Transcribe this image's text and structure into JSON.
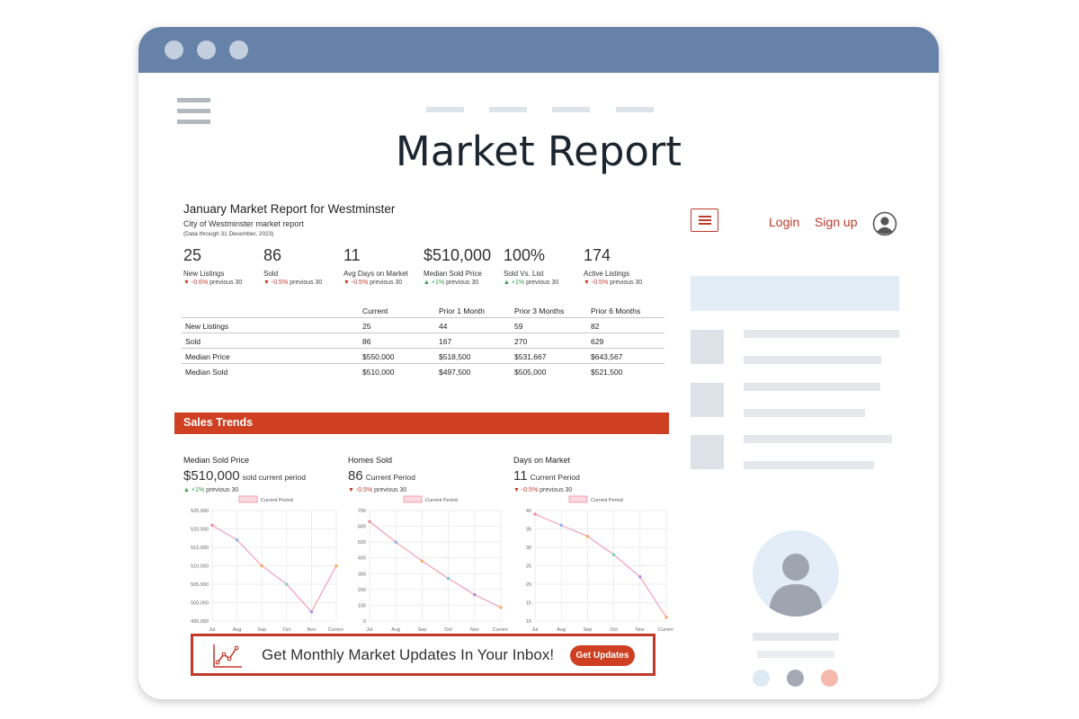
{
  "page": {
    "title": "Market Report"
  },
  "report": {
    "title": "January Market Report for Westminster",
    "subtitle": "City of Westminster market report",
    "note": "(Data through 31 December, 2023)"
  },
  "kpis": [
    {
      "value": "25",
      "label": "New Listings",
      "arrow": "▼",
      "change": "-0.6%",
      "suffix": "previous 30",
      "dir": "dn"
    },
    {
      "value": "86",
      "label": "Sold",
      "arrow": "▼",
      "change": "-0.5%",
      "suffix": "previous 30",
      "dir": "dn"
    },
    {
      "value": "11",
      "label": "Avg Days on Market",
      "arrow": "▼",
      "change": "-0.5%",
      "suffix": "previous 30",
      "dir": "dn"
    },
    {
      "value": "$510,000",
      "label": "Median Sold Price",
      "arrow": "▲",
      "change": "+1%",
      "suffix": "previous 30",
      "dir": "up"
    },
    {
      "value": "100%",
      "label": "Sold Vs. List",
      "arrow": "▲",
      "change": "+1%",
      "suffix": "previous 30",
      "dir": "up"
    },
    {
      "value": "174",
      "label": "Active Listings",
      "arrow": "▼",
      "change": "-0.5%",
      "suffix": "previous 30",
      "dir": "dn"
    }
  ],
  "table": {
    "columns": [
      "",
      "Current",
      "Prior 1 Month",
      "Prior 3 Months",
      "Prior 6 Months"
    ],
    "rows": [
      [
        "New Listings",
        "25",
        "44",
        "59",
        "82"
      ],
      [
        "Sold",
        "86",
        "167",
        "270",
        "629"
      ],
      [
        "Median Price",
        "$550,000",
        "$518,500",
        "$531,667",
        "$643,567"
      ],
      [
        "Median Sold",
        "$510,000",
        "$497,500",
        "$505,000",
        "$521,500"
      ]
    ]
  },
  "section": {
    "title": "Sales Trends"
  },
  "trends": [
    {
      "title": "Median Sold Price",
      "value": "$510,000",
      "value_suffix": "sold current period",
      "arrow": "▲",
      "change": "+1%",
      "change_suffix": "previous 30",
      "dir": "up"
    },
    {
      "title": "Homes Sold",
      "value": "86",
      "value_suffix": "Current Period",
      "arrow": "▼",
      "change": "-0.5%",
      "change_suffix": "previous 30",
      "dir": "dn"
    },
    {
      "title": "Days on Market",
      "value": "11",
      "value_suffix": "Current Period",
      "arrow": "▼",
      "change": "-0.5%",
      "change_suffix": "previous 30",
      "dir": "dn"
    }
  ],
  "chart_data": [
    {
      "type": "line",
      "legend": "Current Period",
      "x": [
        "Jul",
        "Aug",
        "Sep",
        "Oct",
        "Nov",
        "Current"
      ],
      "values": [
        521000,
        517000,
        510000,
        505000,
        497500,
        510000
      ],
      "ylim": [
        495000,
        525000
      ],
      "yticks": [
        495000,
        500000,
        505000,
        510000,
        515000,
        520000,
        525000
      ],
      "ytick_labels": [
        "495,000",
        "500,000",
        "505,000",
        "510,000",
        "515,000",
        "520,000",
        "525,000"
      ],
      "point_colors": [
        "#f08fa5",
        "#8fb4e8",
        "#f5b06a",
        "#7fd0c8",
        "#b48ee8",
        "#f5b06a"
      ],
      "grid": true,
      "legend_position": "top"
    },
    {
      "type": "line",
      "legend": "Current Period",
      "x": [
        "Jul",
        "Aug",
        "Sep",
        "Oct",
        "Nov",
        "Current"
      ],
      "values": [
        630,
        500,
        380,
        270,
        167,
        86
      ],
      "ylim": [
        0,
        700
      ],
      "yticks": [
        0,
        100,
        200,
        300,
        400,
        500,
        600,
        700
      ],
      "ytick_labels": [
        "0",
        "100",
        "200",
        "300",
        "400",
        "500",
        "600",
        "700"
      ],
      "point_colors": [
        "#f08fa5",
        "#8fb4e8",
        "#f5b06a",
        "#7fd0c8",
        "#b48ee8",
        "#f5b06a"
      ],
      "grid": true,
      "legend_position": "top"
    },
    {
      "type": "line",
      "legend": "Current Period",
      "x": [
        "Jul",
        "Aug",
        "Sep",
        "Oct",
        "Nov",
        "Current"
      ],
      "values": [
        39,
        36,
        33,
        28,
        22,
        11
      ],
      "ylim": [
        10,
        40
      ],
      "yticks": [
        10,
        15,
        20,
        25,
        30,
        35,
        40
      ],
      "ytick_labels": [
        "10",
        "15",
        "20",
        "25",
        "30",
        "35",
        "40"
      ],
      "point_colors": [
        "#f08fa5",
        "#8fb4e8",
        "#f5b06a",
        "#7fd0c8",
        "#b48ee8",
        "#f5b06a"
      ],
      "grid": true,
      "legend_position": "top"
    }
  ],
  "cta": {
    "text": "Get Monthly Market Updates In Your Inbox!",
    "button": "Get Updates"
  },
  "sidebar": {
    "login": "Login",
    "signup": "Sign up"
  },
  "colors": {
    "titlebar": "#6782a8",
    "accent": "#cf3f21",
    "down": "#c0392b",
    "up": "#2e9a45",
    "chart_line": "#f08fa5"
  },
  "icons": [
    "hamburger-menu-icon",
    "user-circle-icon",
    "line-chart-icon",
    "avatar-placeholder-icon"
  ]
}
